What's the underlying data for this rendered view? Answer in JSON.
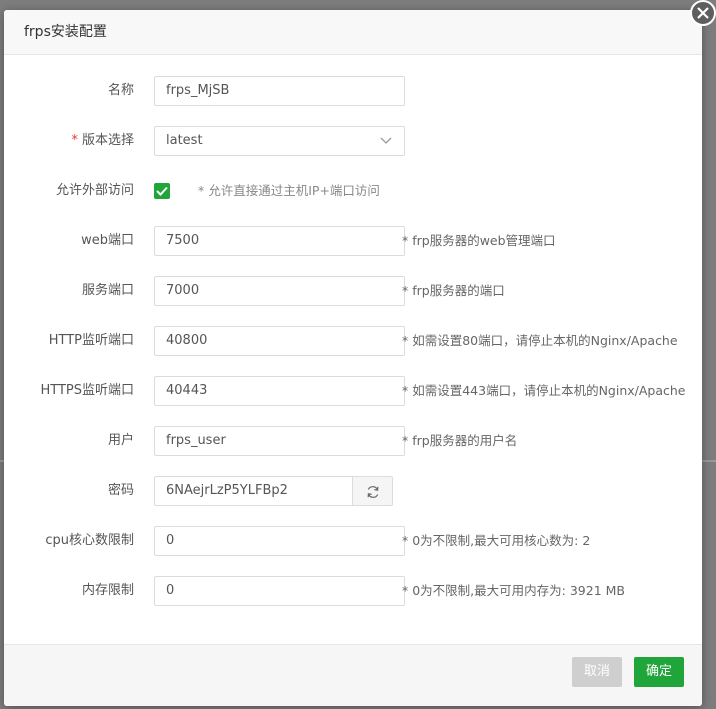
{
  "dialog": {
    "title": "frps安装配置",
    "cancel_label": "取消",
    "confirm_label": "确定"
  },
  "form": {
    "name": {
      "label": "名称",
      "value": "frps_MjSB"
    },
    "version": {
      "required_mark": "*",
      "label": "版本选择",
      "value": "latest"
    },
    "external": {
      "label": "允许外部访问",
      "checked": true,
      "hint": "* 允许直接通过主机IP+端口访问"
    },
    "web_port": {
      "label": "web端口",
      "value": "7500",
      "hint": "* frp服务器的web管理端口"
    },
    "service_port": {
      "label": "服务端口",
      "value": "7000",
      "hint": "* frp服务器的端口"
    },
    "http_port": {
      "label": "HTTP监听端口",
      "value": "40800",
      "hint": "* 如需设置80端口，请停止本机的Nginx/Apache"
    },
    "https_port": {
      "label": "HTTPS监听端口",
      "value": "40443",
      "hint": "* 如需设置443端口，请停止本机的Nginx/Apache"
    },
    "user": {
      "label": "用户",
      "value": "frps_user",
      "hint": "* frp服务器的用户名"
    },
    "password": {
      "label": "密码",
      "value": "6NAejrLzP5YLFBp2"
    },
    "cpu_limit": {
      "label": "cpu核心数限制",
      "value": "0",
      "hint": "* 0为不限制,最大可用核心数为: 2"
    },
    "mem_limit": {
      "label": "内存限制",
      "value": "0",
      "hint": "* 0为不限制,最大可用内存为: 3921 MB"
    }
  },
  "icons": {
    "close": "close-icon",
    "dropdown": "chevron-down-icon",
    "check": "check-icon",
    "refresh": "refresh-icon"
  },
  "colors": {
    "accent": "#20a53a",
    "required": "#e33333",
    "cancel_disabled": "#cfcfcf"
  }
}
